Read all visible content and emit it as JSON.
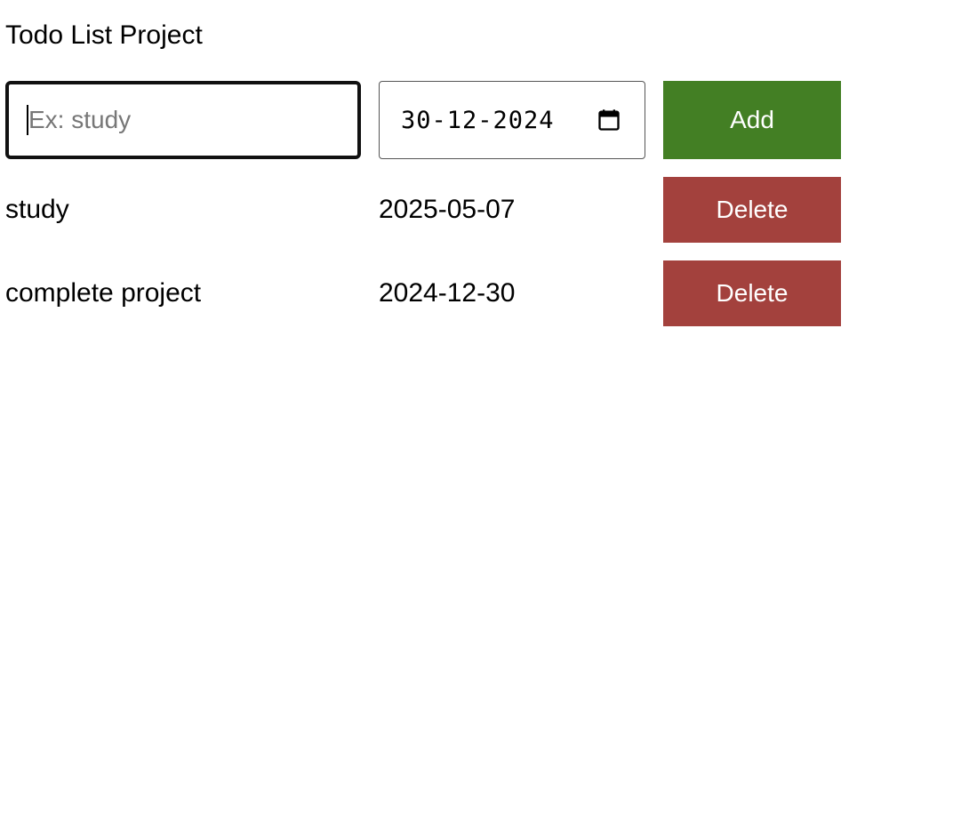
{
  "title": "Todo List Project",
  "form": {
    "name_placeholder": "Ex: study",
    "name_value": "",
    "date_value": "30-12-2024",
    "add_label": "Add"
  },
  "todos": [
    {
      "name": "study",
      "due_date": "2025-05-07",
      "delete_label": "Delete"
    },
    {
      "name": "complete project",
      "due_date": "2024-12-30",
      "delete_label": "Delete"
    }
  ],
  "colors": {
    "add_button": "#437f24",
    "delete_button": "#a3413d"
  },
  "icons": {
    "date_picker": "calendar-icon"
  }
}
